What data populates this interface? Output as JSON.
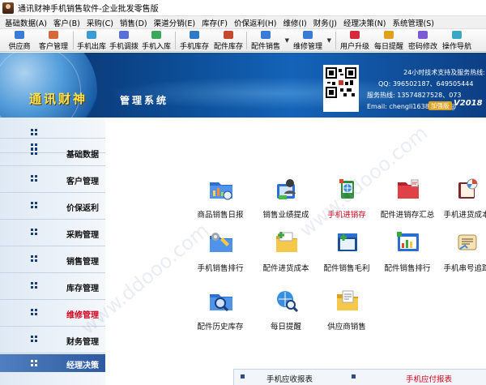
{
  "window": {
    "title": "通讯财神手机销售软件-企业批发零售版"
  },
  "menu": [
    "基础数据(A)",
    "客户(B)",
    "采购(C)",
    "销售(D)",
    "渠道分销(E)",
    "库存(F)",
    "价保返利(H)",
    "维修(I)",
    "财务(J)",
    "经理决策(N)",
    "系统管理(S)"
  ],
  "toolbar": {
    "buttons": [
      {
        "label": "供应商",
        "color": "#3a7bd5"
      },
      {
        "label": "客户管理",
        "color": "#d5693a"
      },
      {
        "label": "手机出库",
        "color": "#3a9bd5"
      },
      {
        "label": "手机调拨",
        "color": "#5a6fd5"
      },
      {
        "label": "手机入库",
        "color": "#3aa85a"
      },
      {
        "label": "手机库存",
        "color": "#2f7ac4"
      },
      {
        "label": "配件库存",
        "color": "#c44a2f"
      },
      {
        "label": "配件销售",
        "color": "#3a7bd5"
      },
      {
        "label": "维修管理",
        "color": "#3a7bd5"
      },
      {
        "label": "用户升级",
        "color": "#d52a3a"
      },
      {
        "label": "每日提醒",
        "color": "#e0a020"
      },
      {
        "label": "密码修改",
        "color": "#7a5ad5"
      },
      {
        "label": "操作导航",
        "color": "#3aa8c4"
      }
    ]
  },
  "banner": {
    "brand": "通讯财神",
    "brand_sub": "管理系统",
    "contact": {
      "head": "24小时技术支持及服务热线:",
      "qq": "QQ: 396502187、649505444",
      "phone": "服务热线: 13574827528、073",
      "email": "Email: chengli163888888@"
    },
    "edition_badge": "加强版",
    "edition_year": "V2018"
  },
  "sidebar": {
    "items": [
      {
        "label": "",
        "active": false
      },
      {
        "label": "",
        "active": false
      },
      {
        "label": "基础数据",
        "active": false
      },
      {
        "label": "客户管理",
        "active": false
      },
      {
        "label": "价保返利",
        "active": false
      },
      {
        "label": "采购管理",
        "active": false
      },
      {
        "label": "销售管理",
        "active": false
      },
      {
        "label": "库存管理",
        "active": false
      },
      {
        "label": "维修管理",
        "active": true
      },
      {
        "label": "财务管理",
        "active": false
      },
      {
        "label": "经理决策",
        "active": false
      }
    ]
  },
  "tiles": [
    {
      "label": "商品销售日报",
      "icon": "folder-chart-icon",
      "highlight": false
    },
    {
      "label": "销售业绩提成",
      "icon": "person-cash-icon",
      "highlight": false
    },
    {
      "label": "手机进销存",
      "icon": "phone-globe-icon",
      "highlight": true
    },
    {
      "label": "配件进销存汇总",
      "icon": "red-folder-icon",
      "highlight": false
    },
    {
      "label": "手机进货成本",
      "icon": "chart-book-icon",
      "highlight": false
    },
    {
      "label": "手机销售排行",
      "icon": "folder-tools-icon",
      "highlight": false
    },
    {
      "label": "配件进货成本",
      "icon": "folder-plus-icon",
      "highlight": false
    },
    {
      "label": "配件销售毛利",
      "icon": "window-plus-icon",
      "highlight": false
    },
    {
      "label": "配件销售排行",
      "icon": "chart-window-icon",
      "highlight": false
    },
    {
      "label": "手机串号追踪",
      "icon": "scroll-icon",
      "highlight": false
    },
    {
      "label": "配件历史库存",
      "icon": "folder-search-icon",
      "highlight": false
    },
    {
      "label": "每日提醒",
      "icon": "globe-search-icon",
      "highlight": false
    },
    {
      "label": "供应商销售",
      "icon": "folder-doc-icon",
      "highlight": false
    }
  ],
  "bottom_panel": {
    "left": "手机应收报表",
    "right": "手机应付报表"
  },
  "watermark": "www.ddooo.com"
}
